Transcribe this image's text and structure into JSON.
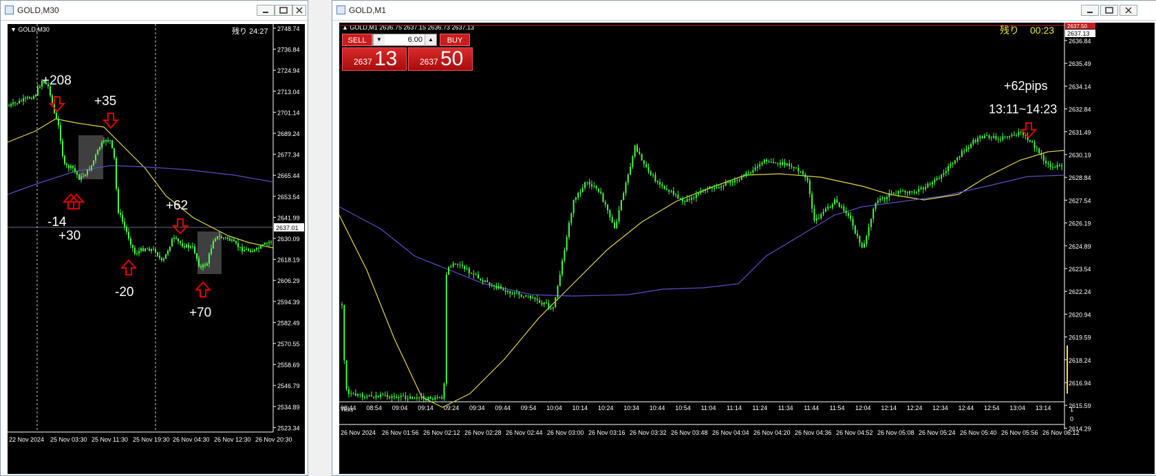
{
  "left_window": {
    "title": "GOLD,M30",
    "chart_label": "GOLD,M30",
    "remaining": "残り 24:27",
    "price_axis": [
      "2748.74",
      "2736.84",
      "2724.94",
      "2713.04",
      "2701.14",
      "2689.24",
      "2677.34",
      "2665.44",
      "2653.54",
      "2641.99",
      "2630.09",
      "2618.19",
      "2606.29",
      "2594.39",
      "2582.49",
      "2570.55",
      "2558.69",
      "2546.79",
      "2534.89",
      "2523.34"
    ],
    "current_price": "2637.01",
    "time_axis": [
      "22 Nov 2024",
      "25 Nov 03:30",
      "25 Nov 11:30",
      "25 Nov 19:30",
      "26 Nov 04:30",
      "26 Nov 12:30",
      "26 Nov 20:30"
    ],
    "annotations": [
      "+208",
      "+35",
      "-14",
      "+30",
      "+62",
      "-20",
      "+70"
    ]
  },
  "right_window": {
    "title": "GOLD,M1",
    "chart_header": "GOLD,M1  2636.75 2637.15 2636.73 2637.13",
    "remaining_label": "残り",
    "remaining_time": "00:23",
    "current_price": "2637.13",
    "top_price": "2637.50",
    "trade_panel": {
      "sell_label": "SELL",
      "buy_label": "BUY",
      "lot": "6.00",
      "sell_small": "2637",
      "sell_big": "13",
      "buy_small": "2637",
      "buy_big": "50"
    },
    "price_axis": [
      "2636.84",
      "2635.49",
      "2634.14",
      "2632.84",
      "2631.49",
      "2630.19",
      "2628.84",
      "2627.54",
      "2626.19",
      "2624.89",
      "2623.54",
      "2622.24",
      "2620.94",
      "2619.59",
      "2618.24",
      "2616.94",
      "2615.59",
      "2614.29"
    ],
    "tick_axis_label": "Ticks",
    "tick_times": [
      "08:44",
      "08:54",
      "09:04",
      "09:14",
      "09:24",
      "09:34",
      "09:44",
      "09:54",
      "10:04",
      "10:14",
      "10:24",
      "10:34",
      "10:44",
      "10:54",
      "11:04",
      "11:14",
      "11:24",
      "11:34",
      "11:44",
      "11:54",
      "12:04",
      "12:14",
      "12:24",
      "12:34",
      "12:44",
      "12:54",
      "13:04",
      "13:14"
    ],
    "time_axis": [
      "26 Nov 2024",
      "26 Nov 01:56",
      "26 Nov 02:12",
      "26 Nov 02:28",
      "26 Nov 02:44",
      "26 Nov 03:00",
      "26 Nov 03:16",
      "26 Nov 03:32",
      "26 Nov 03:48",
      "26 Nov 04:04",
      "26 Nov 04:20",
      "26 Nov 04:36",
      "26 Nov 04:52",
      "26 Nov 05:08",
      "26 Nov 05:24",
      "26 Nov 05:40",
      "26 Nov 05:56",
      "26 Nov 06:12"
    ],
    "annotation_pips": "+62pips",
    "annotation_range": "13:11~14:23"
  },
  "colors": {
    "candle": "#44ff44",
    "ma_fast": "#e8d84a",
    "ma_slow": "#5a4fc8",
    "arrow": "#e00000",
    "accent_sell": "#c81e1e"
  }
}
